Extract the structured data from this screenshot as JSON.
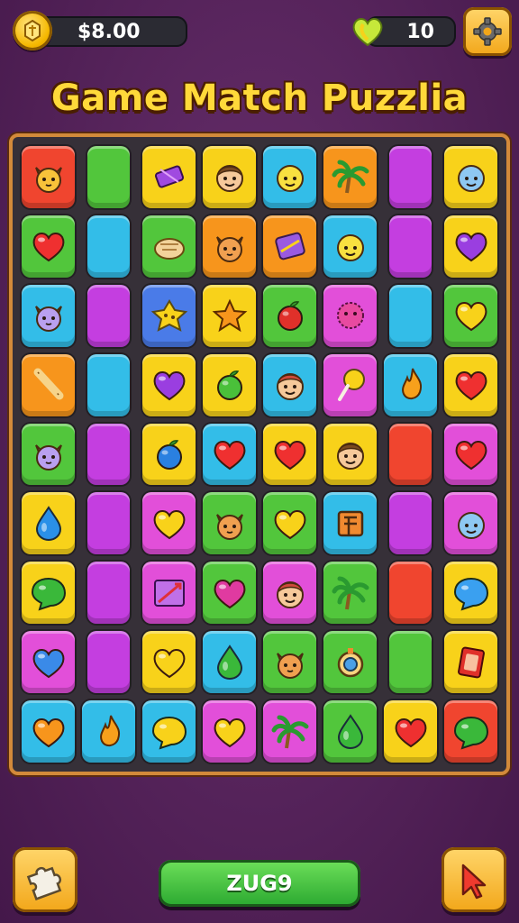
{
  "header": {
    "coins": "$8.00",
    "lives": "10",
    "title": "Game Match Puzzlia"
  },
  "footer": {
    "main_button": "ZUG9"
  },
  "colors": {
    "red": "#f0452f",
    "green": "#52c63c",
    "yellow": "#f8d21a",
    "cyan": "#33bde8",
    "orange": "#f7951c",
    "purple": "#c43ee0",
    "magenta": "#e24fd9",
    "blue": "#4a7be8"
  },
  "board": {
    "rows": [
      [
        {
          "c": "red",
          "i": "cat-face"
        },
        {
          "c": "green",
          "i": ""
        },
        {
          "c": "yellow",
          "i": "candy-bar"
        },
        {
          "c": "yellow",
          "i": "boy-face"
        },
        {
          "c": "cyan",
          "i": "lemon-face"
        },
        {
          "c": "orange",
          "i": "palm-tree"
        },
        {
          "c": "purple",
          "i": ""
        },
        {
          "c": "yellow",
          "i": "blue-face"
        }
      ],
      [
        {
          "c": "green",
          "i": "heart-red"
        },
        {
          "c": "cyan",
          "i": ""
        },
        {
          "c": "green",
          "i": "bread"
        },
        {
          "c": "orange",
          "i": "fox-face"
        },
        {
          "c": "orange",
          "i": "purple-gem"
        },
        {
          "c": "cyan",
          "i": "lemon-face"
        },
        {
          "c": "purple",
          "i": ""
        },
        {
          "c": "yellow",
          "i": "heart-purple"
        }
      ],
      [
        {
          "c": "cyan",
          "i": "purple-cat"
        },
        {
          "c": "purple",
          "i": ""
        },
        {
          "c": "blue",
          "i": "cookie"
        },
        {
          "c": "yellow",
          "i": "star-orange"
        },
        {
          "c": "green",
          "i": "apple-red"
        },
        {
          "c": "magenta",
          "i": "fuzzball"
        },
        {
          "c": "cyan",
          "i": ""
        },
        {
          "c": "green",
          "i": "heart-yellow"
        }
      ],
      [
        {
          "c": "orange",
          "i": "bone"
        },
        {
          "c": "cyan",
          "i": ""
        },
        {
          "c": "yellow",
          "i": "heart-purple"
        },
        {
          "c": "yellow",
          "i": "apple-green"
        },
        {
          "c": "cyan",
          "i": "girl-face"
        },
        {
          "c": "magenta",
          "i": "lollipop"
        },
        {
          "c": "cyan",
          "i": "flame"
        },
        {
          "c": "yellow",
          "i": "heart-red"
        }
      ],
      [
        {
          "c": "green",
          "i": "purple-cat"
        },
        {
          "c": "purple",
          "i": ""
        },
        {
          "c": "yellow",
          "i": "berry-blue"
        },
        {
          "c": "cyan",
          "i": "heart-red"
        },
        {
          "c": "yellow",
          "i": "heart-red"
        },
        {
          "c": "yellow",
          "i": "boy-face"
        },
        {
          "c": "red",
          "i": ""
        },
        {
          "c": "magenta",
          "i": "heart-red"
        }
      ],
      [
        {
          "c": "yellow",
          "i": "drop-blue"
        },
        {
          "c": "purple",
          "i": ""
        },
        {
          "c": "magenta",
          "i": "heart-yellow"
        },
        {
          "c": "green",
          "i": "fox-face"
        },
        {
          "c": "green",
          "i": "heart-yellow"
        },
        {
          "c": "cyan",
          "i": "box"
        },
        {
          "c": "purple",
          "i": ""
        },
        {
          "c": "magenta",
          "i": "blue-face"
        }
      ],
      [
        {
          "c": "yellow",
          "i": "bubble-green"
        },
        {
          "c": "purple",
          "i": ""
        },
        {
          "c": "magenta",
          "i": "map"
        },
        {
          "c": "green",
          "i": "heart-magenta"
        },
        {
          "c": "magenta",
          "i": "girl-face"
        },
        {
          "c": "green",
          "i": "palm-tree"
        },
        {
          "c": "red",
          "i": ""
        },
        {
          "c": "yellow",
          "i": "bubble-blue"
        }
      ],
      [
        {
          "c": "magenta",
          "i": "heart-blue"
        },
        {
          "c": "purple",
          "i": ""
        },
        {
          "c": "yellow",
          "i": "heart-yellow"
        },
        {
          "c": "cyan",
          "i": "drop-green"
        },
        {
          "c": "green",
          "i": "fox-face"
        },
        {
          "c": "green",
          "i": "compass"
        },
        {
          "c": "green",
          "i": ""
        },
        {
          "c": "yellow",
          "i": "card-red"
        }
      ],
      [
        {
          "c": "cyan",
          "i": "heart-orange"
        },
        {
          "c": "cyan",
          "i": "flame"
        },
        {
          "c": "cyan",
          "i": "bubble-yellow"
        },
        {
          "c": "magenta",
          "i": "heart-yellow"
        },
        {
          "c": "magenta",
          "i": "palm-tree"
        },
        {
          "c": "green",
          "i": "drop-green"
        },
        {
          "c": "yellow",
          "i": "heart-red"
        },
        {
          "c": "red",
          "i": "bubble-green"
        }
      ]
    ]
  }
}
